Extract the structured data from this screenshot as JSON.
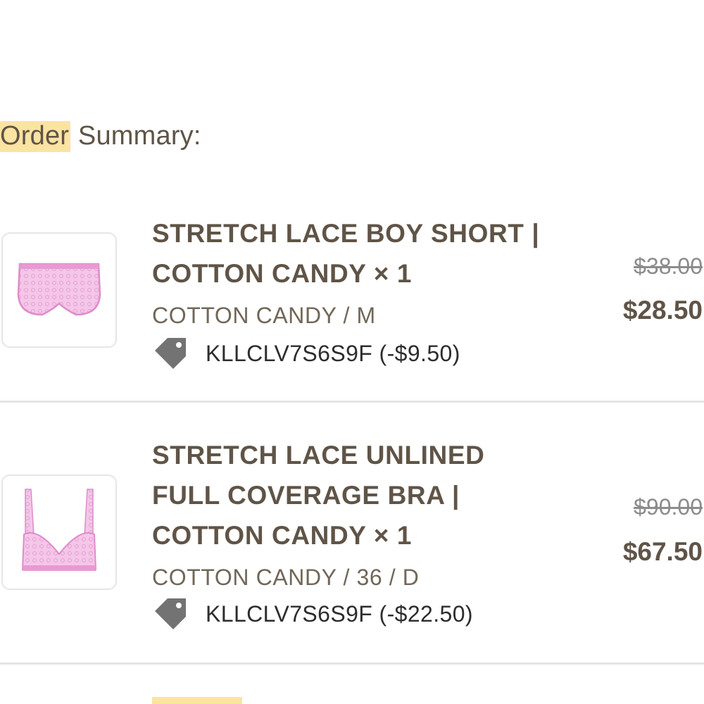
{
  "summary": {
    "highlighted_word": "Order",
    "rest": " Summary:"
  },
  "items": [
    {
      "title_line1": "STRETCH LACE BOY SHORT |",
      "title_line2": "COTTON CANDY × 1",
      "variant": "COTTON CANDY / M",
      "discount": "KLLCLV7S6S9F (-$9.50)",
      "price_original": "$38.00",
      "price_final": "$28.50",
      "image_icon": "boy-short-thumbnail"
    },
    {
      "title_line1": "STRETCH LACE UNLINED",
      "title_line2": "FULL COVERAGE BRA |",
      "title_line3": "COTTON CANDY × 1",
      "variant": "COTTON CANDY / 36 / D",
      "discount": "KLLCLV7S6S9F (-$22.50)",
      "price_original": "$90.00",
      "price_final": "$67.50",
      "image_icon": "bra-thumbnail"
    }
  ],
  "colors": {
    "highlight": "#fbe3a2",
    "text": "#5f5447",
    "product_pink": "#f1b7e2",
    "tag_grey": "#737373"
  }
}
